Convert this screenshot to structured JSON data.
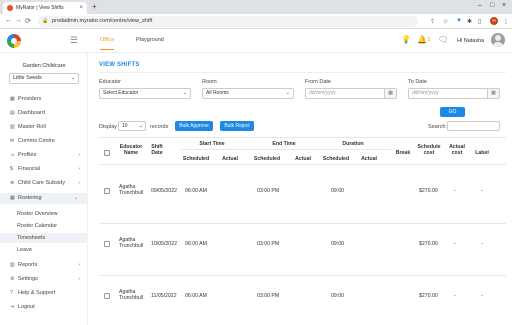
{
  "browser": {
    "tab_title": "MyRator | View Shifts",
    "tab_close": "×",
    "new_tab": "+",
    "url": "prodadmin.myrator.com/centre/view_shift",
    "profile_initial": "H"
  },
  "app": {
    "top_tabs": [
      "Office",
      "Playground"
    ],
    "notification_count": "5",
    "greeting": "Hi Natasha"
  },
  "sidebar": {
    "center_name": "Garden Childcare",
    "center_select": "Little Seeds",
    "items": [
      {
        "label": "Providers",
        "icon": "providers-icon"
      },
      {
        "label": "Dashboard",
        "icon": "dashboard-icon"
      },
      {
        "label": "Master Roll",
        "icon": "master-roll-icon"
      },
      {
        "label": "Comms Centre",
        "icon": "comms-icon"
      },
      {
        "label": "Profiles",
        "icon": "profiles-icon"
      },
      {
        "label": "Financial",
        "icon": "financial-icon"
      },
      {
        "label": "Child Care Subsidy",
        "icon": "subsidy-icon"
      },
      {
        "label": "Rostering",
        "icon": "rostering-icon"
      }
    ],
    "sub_items": [
      "Roster Overview",
      "Roster Calendar",
      "Timesheets",
      "Leave"
    ],
    "bottom_items": [
      {
        "label": "Reports",
        "icon": "reports-icon"
      },
      {
        "label": "Settings",
        "icon": "settings-icon"
      },
      {
        "label": "Help & Support",
        "icon": "help-icon"
      },
      {
        "label": "Logout",
        "icon": "logout-icon"
      }
    ]
  },
  "page": {
    "title": "VIEW SHIFTS",
    "filters": {
      "educator_label": "Educator",
      "educator_value": "Select Educator",
      "room_label": "Room",
      "room_value": "All Rooms",
      "from_label": "From Date",
      "from_placeholder": "dd/mm/yyyy",
      "to_label": "To Date",
      "to_placeholder": "dd/mm/yyyy",
      "go": "GO"
    },
    "controls": {
      "display": "Display",
      "length": "10",
      "records": "records",
      "bulk_approve": "Bulk Approve",
      "bulk_reject": "Bulk Reject",
      "search": "Search:"
    },
    "table": {
      "headers": {
        "educator_name": "Educator Name",
        "shift_date": "Shift Date",
        "start_time": "Start Time",
        "end_time": "End Time",
        "duration": "Duration",
        "break": "Break",
        "schedule_cost": "Schedule cost",
        "actual_cost": "Actual cost",
        "label": "Label",
        "scheduled": "Scheduled",
        "actual": "Actual"
      },
      "rows": [
        {
          "name": "Agatha Trunchbull",
          "date": "09/05/2022",
          "start": "06:00 AM",
          "end": "03:00 PM",
          "duration": "09:00",
          "cost": "$270.00",
          "actual_cost": "-",
          "label": "-"
        },
        {
          "name": "Agatha Trunchbull",
          "date": "10/05/2022",
          "start": "06:00 AM",
          "end": "03:00 PM",
          "duration": "09:00",
          "cost": "$270.00",
          "actual_cost": "-",
          "label": "-"
        },
        {
          "name": "Agatha Trunchbull",
          "date": "11/05/2022",
          "start": "06:00 AM",
          "end": "03:00 PM",
          "duration": "09:00",
          "cost": "$270.00",
          "actual_cost": "-",
          "label": "-"
        }
      ]
    }
  },
  "colors": {
    "accent": "#1e88e5",
    "active_tab": "#f39c12"
  }
}
